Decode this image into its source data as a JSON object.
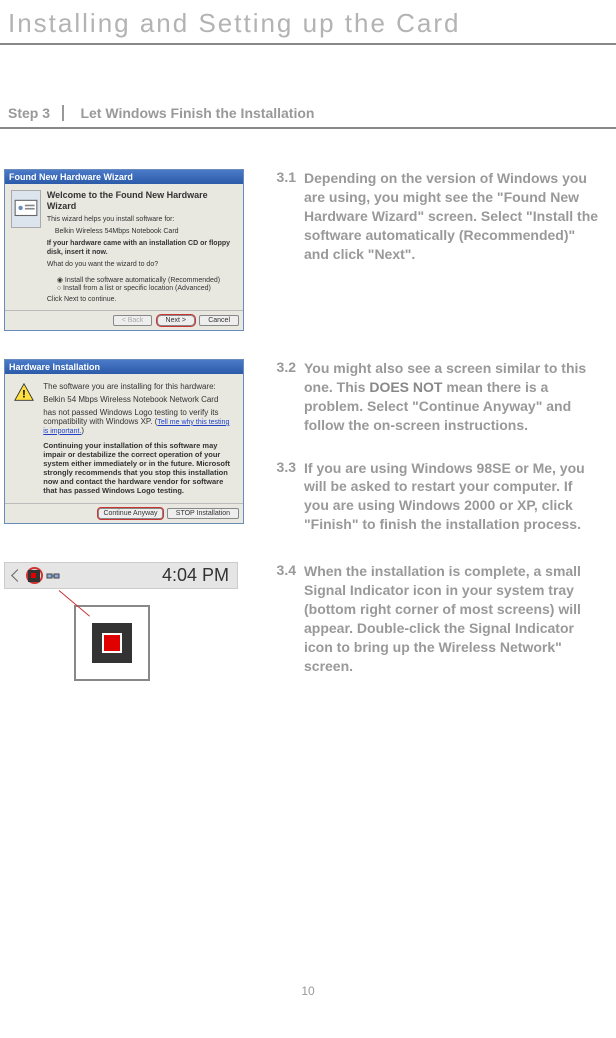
{
  "page_title": "Installing and Setting up the Card",
  "page_number": "10",
  "step_label": "Step 3",
  "step_title": "Let Windows Finish the Installation",
  "dialog1": {
    "title": "Found New Hardware Wizard",
    "heading": "Welcome to the Found New Hardware Wizard",
    "sub1": "This wizard helps you install software for:",
    "device": "Belkin Wireless 54Mbps Notebook Card",
    "cd_notice": "If your hardware came with an installation CD or floppy disk, insert it now.",
    "question": "What do you want the wizard to do?",
    "opt1": "Install the software automatically (Recommended)",
    "opt2": "Install from a list or specific location (Advanced)",
    "continue_text": "Click Next to continue.",
    "back": "< Back",
    "next": "Next >",
    "cancel": "Cancel"
  },
  "dialog2": {
    "title": "Hardware Installation",
    "line1": "The software you are installing for this hardware:",
    "device": "Belkin 54 Mbps Wireless Notebook Network Card",
    "line2_a": "has not passed Windows Logo testing to verify its compatibility with Windows XP. (",
    "line2_link": "Tell me why this testing is important.",
    "line2_b": ")",
    "warn_bold": "Continuing your installation of this software may impair or destabilize the correct operation of your system either immediately or in the future. Microsoft strongly recommends that you stop this installation now and contact the hardware vendor for software that has passed Windows Logo testing.",
    "continue": "Continue Anyway",
    "stop": "STOP Installation"
  },
  "tray": {
    "time": "4:04 PM"
  },
  "steps": {
    "s31_num": "3.1",
    "s31_text": "Depending on the version of Windows you are using, you might see the \"Found New Hardware Wizard\" screen. Select \"Install the software automatically (Recommended)\" and click \"Next\".",
    "s32_num": "3.2",
    "s32_text_a": "You might also see a screen similar to this one. This ",
    "s32_strong": "DOES NOT",
    "s32_text_b": " mean there is a problem. Select \"Continue Anyway\" and follow the on-screen instructions.",
    "s33_num": "3.3",
    "s33_text": "If you are using Windows 98SE or Me, you will be asked to restart your computer. If you are using Windows 2000 or XP, click \"Finish\" to finish the installation process.",
    "s34_num": "3.4",
    "s34_text": "When the installation is complete, a small Signal Indicator icon in your system tray (bottom right corner of most screens) will appear. Double-click the Signal Indicator icon to bring up the Wireless Network\" screen."
  }
}
